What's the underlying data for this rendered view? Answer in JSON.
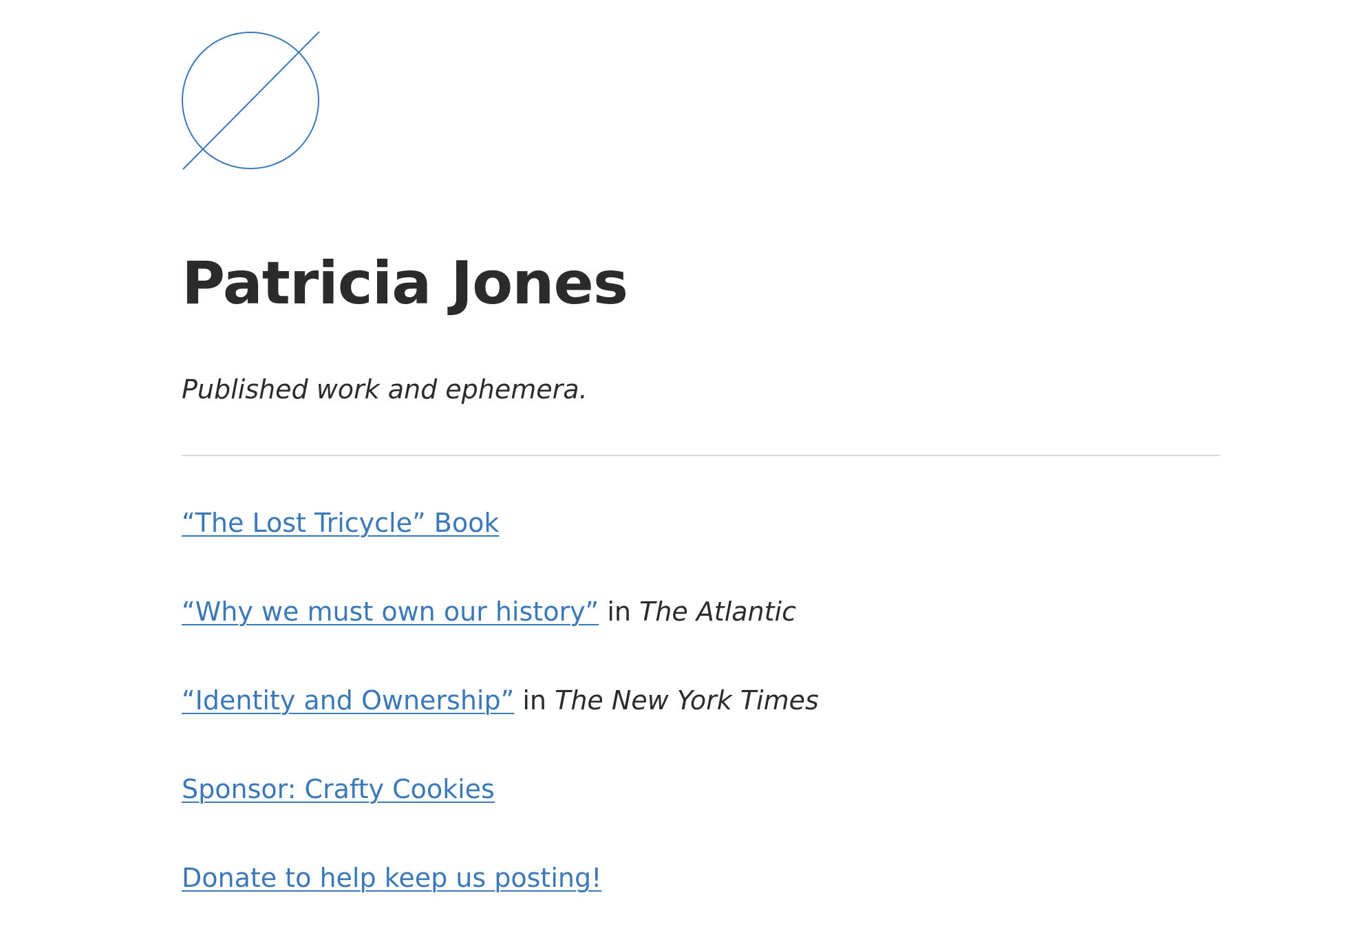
{
  "theme": {
    "accent": "#3a78b8",
    "text": "#2b2b2b",
    "divider": "#d6d6d6"
  },
  "header": {
    "logo_icon": "empty-set-icon",
    "title": "Patricia Jones",
    "tagline": "Published work and ephemera."
  },
  "links": [
    {
      "link_text": "“The Lost Tricycle” Book",
      "connector": "",
      "publication": ""
    },
    {
      "link_text": "“Why we must own our history”",
      "connector": " in ",
      "publication": "The Atlantic"
    },
    {
      "link_text": "“Identity and Ownership”",
      "connector": " in ",
      "publication": "The New York Times"
    },
    {
      "link_text": "Sponsor: Crafty Cookies",
      "connector": "",
      "publication": ""
    },
    {
      "link_text": "Donate to help keep us posting!",
      "connector": "",
      "publication": ""
    }
  ]
}
